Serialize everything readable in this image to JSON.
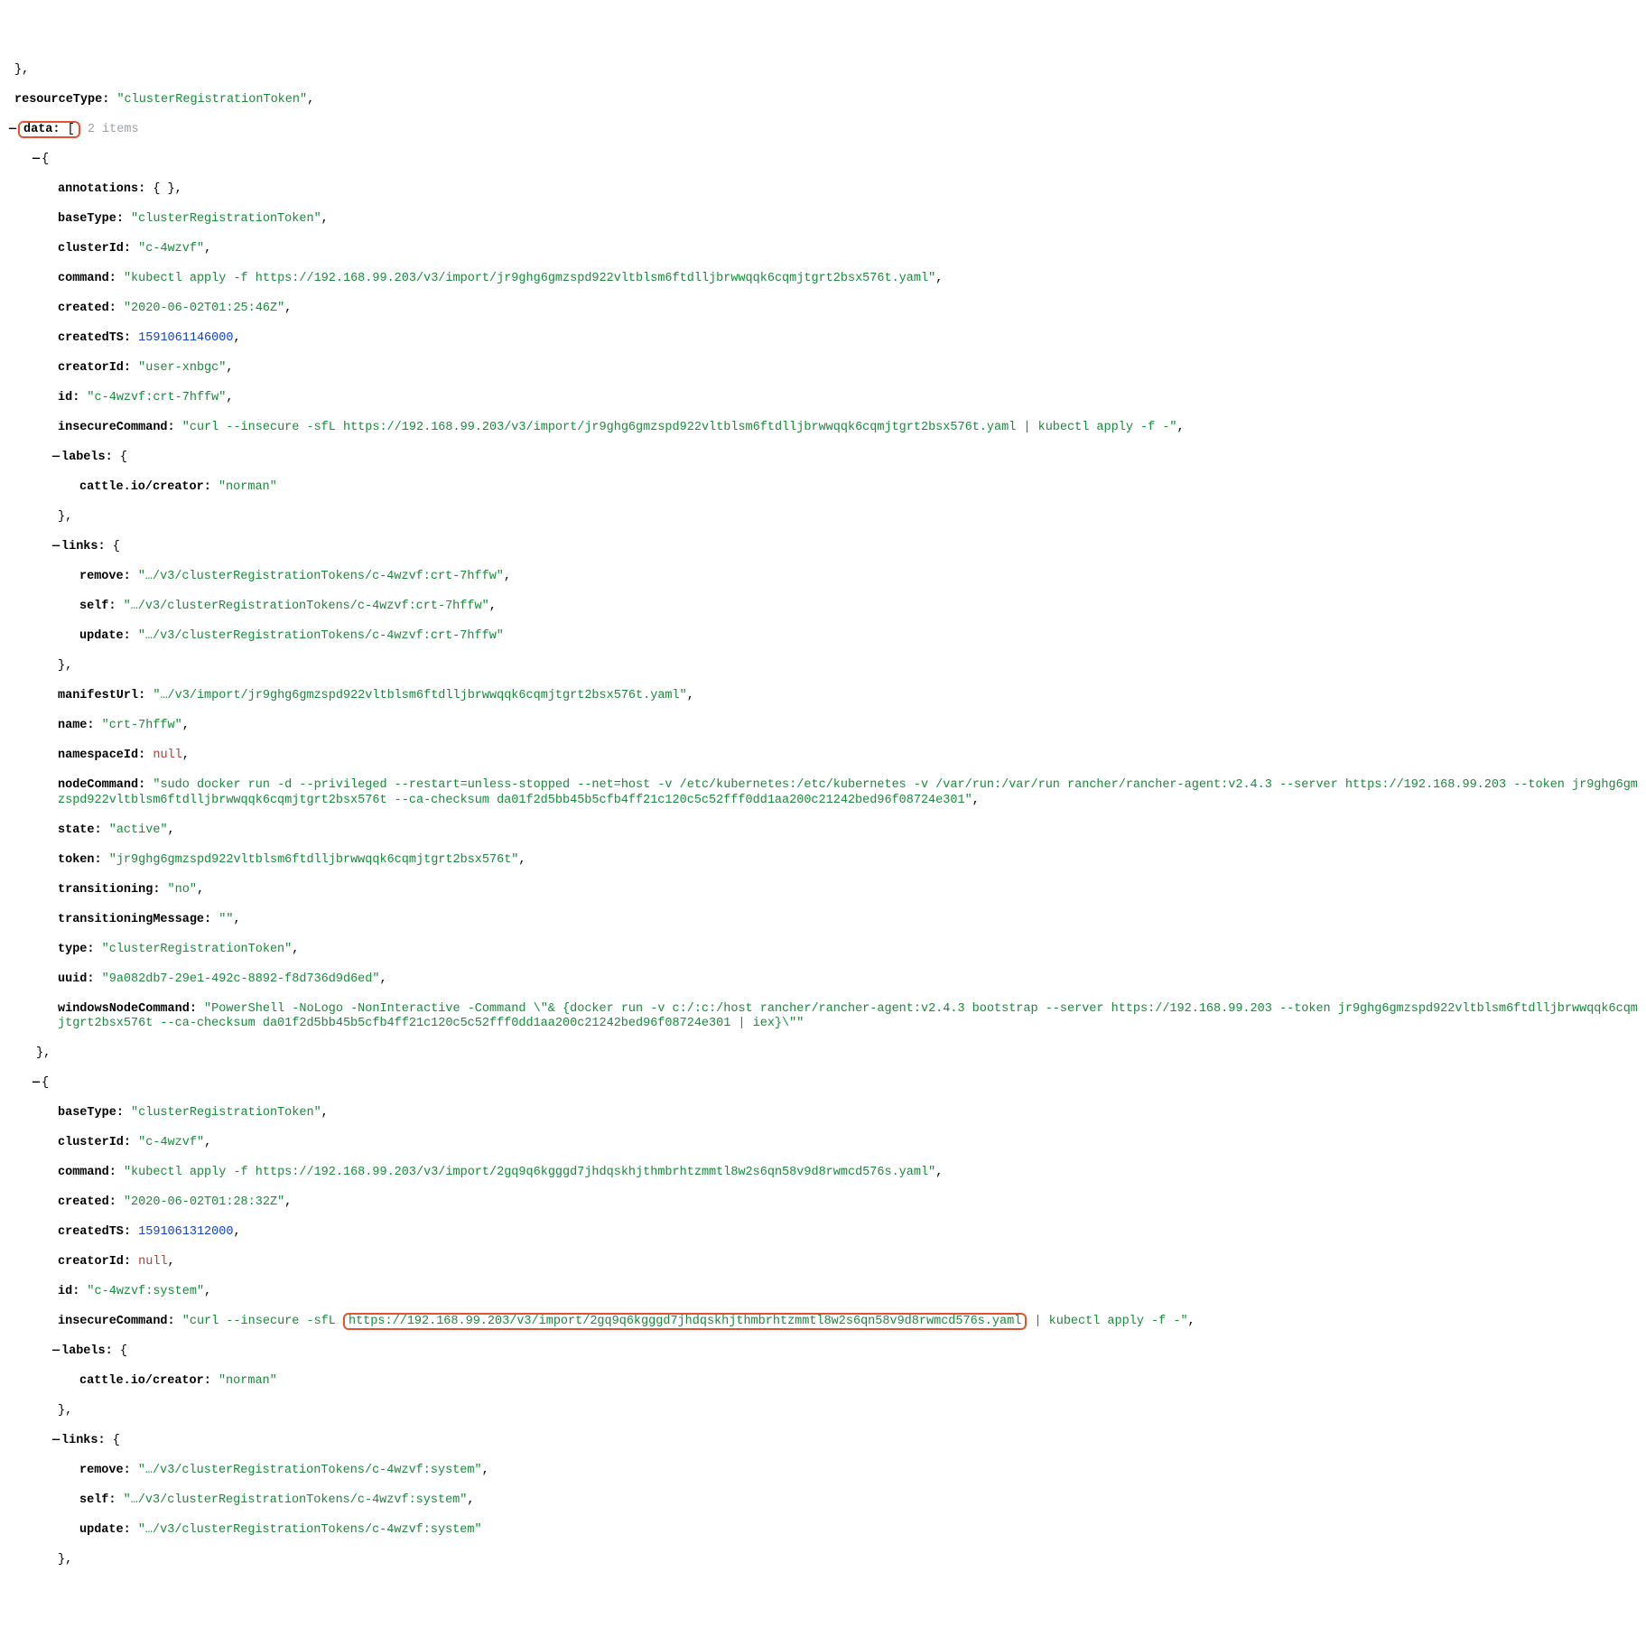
{
  "top": {
    "resourceType_key": "resourceType",
    "resourceType": "\"clusterRegistrationToken\"",
    "data_key": "data",
    "items_hint": "2 items"
  },
  "item1": {
    "annotations_key": "annotations",
    "annotations_val": "{ }",
    "baseType_key": "baseType",
    "baseType": "\"clusterRegistrationToken\"",
    "clusterId_key": "clusterId",
    "clusterId": "\"c-4wzvf\"",
    "command_key": "command",
    "command": "\"kubectl apply -f https://192.168.99.203/v3/import/jr9ghg6gmzspd922vltblsm6ftdlljbrwwqqk6cqmjtgrt2bsx576t.yaml\"",
    "created_key": "created",
    "created": "\"2020-06-02T01:25:46Z\"",
    "createdTS_key": "createdTS",
    "createdTS": "1591061146000",
    "creatorId_key": "creatorId",
    "creatorId": "\"user-xnbgc\"",
    "id_key": "id",
    "id": "\"c-4wzvf:crt-7hffw\"",
    "insecureCommand_key": "insecureCommand",
    "insecureCommand": "\"curl --insecure -sfL https://192.168.99.203/v3/import/jr9ghg6gmzspd922vltblsm6ftdlljbrwwqqk6cqmjtgrt2bsx576t.yaml | kubectl apply -f -\"",
    "labels_key": "labels",
    "labels_inner_key": "cattle.io/creator",
    "labels_inner": "\"norman\"",
    "links_key": "links",
    "links_remove_key": "remove",
    "links_remove": "\"…/v3/clusterRegistrationTokens/c-4wzvf:crt-7hffw\"",
    "links_self_key": "self",
    "links_self": "\"…/v3/clusterRegistrationTokens/c-4wzvf:crt-7hffw\"",
    "links_update_key": "update",
    "links_update": "\"…/v3/clusterRegistrationTokens/c-4wzvf:crt-7hffw\"",
    "manifestUrl_key": "manifestUrl",
    "manifestUrl": "\"…/v3/import/jr9ghg6gmzspd922vltblsm6ftdlljbrwwqqk6cqmjtgrt2bsx576t.yaml\"",
    "name_key": "name",
    "name": "\"crt-7hffw\"",
    "namespaceId_key": "namespaceId",
    "namespaceId": "null",
    "nodeCommand_key": "nodeCommand",
    "nodeCommand": "\"sudo docker run -d --privileged --restart=unless-stopped --net=host -v /etc/kubernetes:/etc/kubernetes -v /var/run:/var/run rancher/rancher-agent:v2.4.3 --server https://192.168.99.203 --token jr9ghg6gmzspd922vltblsm6ftdlljbrwwqqk6cqmjtgrt2bsx576t --ca-checksum da01f2d5bb45b5cfb4ff21c120c5c52fff0dd1aa200c21242bed96f08724e301\"",
    "state_key": "state",
    "state": "\"active\"",
    "token_key": "token",
    "token": "\"jr9ghg6gmzspd922vltblsm6ftdlljbrwwqqk6cqmjtgrt2bsx576t\"",
    "transitioning_key": "transitioning",
    "transitioning": "\"no\"",
    "transitioningMessage_key": "transitioningMessage",
    "transitioningMessage": "\"\"",
    "type_key": "type",
    "type": "\"clusterRegistrationToken\"",
    "uuid_key": "uuid",
    "uuid": "\"9a082db7-29e1-492c-8892-f8d736d9d6ed\"",
    "windowsNodeCommand_key": "windowsNodeCommand",
    "windowsNodeCommand": "\"PowerShell -NoLogo -NonInteractive -Command \\\"& {docker run -v c:/:c:/host rancher/rancher-agent:v2.4.3 bootstrap --server https://192.168.99.203 --token jr9ghg6gmzspd922vltblsm6ftdlljbrwwqqk6cqmjtgrt2bsx576t --ca-checksum da01f2d5bb45b5cfb4ff21c120c5c52fff0dd1aa200c21242bed96f08724e301 | iex}\\\"\""
  },
  "item2": {
    "baseType_key": "baseType",
    "baseType": "\"clusterRegistrationToken\"",
    "clusterId_key": "clusterId",
    "clusterId": "\"c-4wzvf\"",
    "command_key": "command",
    "command": "\"kubectl apply -f https://192.168.99.203/v3/import/2gq9q6kgggd7jhdqskhjthmbrhtzmmtl8w2s6qn58v9d8rwmcd576s.yaml\"",
    "created_key": "created",
    "created": "\"2020-06-02T01:28:32Z\"",
    "createdTS_key": "createdTS",
    "createdTS": "1591061312000",
    "creatorId_key": "creatorId",
    "creatorId": "null",
    "id_key": "id",
    "id": "\"c-4wzvf:system\"",
    "insecureCommand_key": "insecureCommand",
    "insecureCommand_pre": "\"curl --insecure -sfL ",
    "insecureCommand_hl": "https://192.168.99.203/v3/import/2gq9q6kgggd7jhdqskhjthmbrhtzmmtl8w2s6qn58v9d8rwmcd576s.yaml",
    "insecureCommand_post": " | kubectl apply -f -\"",
    "labels_key": "labels",
    "labels_inner_key": "cattle.io/creator",
    "labels_inner": "\"norman\"",
    "links_key": "links",
    "links_remove_key": "remove",
    "links_remove": "\"…/v3/clusterRegistrationTokens/c-4wzvf:system\"",
    "links_self_key": "self",
    "links_self": "\"…/v3/clusterRegistrationTokens/c-4wzvf:system\"",
    "links_update_key": "update",
    "links_update": "\"…/v3/clusterRegistrationTokens/c-4wzvf:system\""
  },
  "sym": {
    "minus": "—",
    "comma": ",",
    "colon": ":",
    "open_curly": "{",
    "close_curly": "}",
    "open_square": "[",
    "close_square": "]"
  }
}
